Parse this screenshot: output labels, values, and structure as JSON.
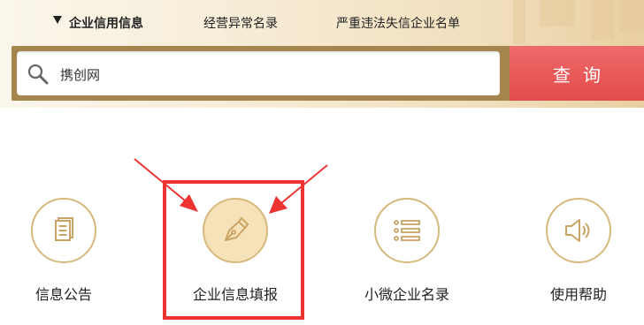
{
  "tabs": [
    {
      "label": "企业信用信息",
      "active": true
    },
    {
      "label": "经营异常名录",
      "active": false
    },
    {
      "label": "严重违法失信企业名单",
      "active": false
    }
  ],
  "search": {
    "value": "携创网",
    "icon": "search-icon",
    "button_label": "查询"
  },
  "services": [
    {
      "label": "信息公告",
      "icon": "document-icon"
    },
    {
      "label": "企业信息填报",
      "icon": "pen-nib-icon",
      "highlighted": true
    },
    {
      "label": "小微企业名录",
      "icon": "list-icon"
    },
    {
      "label": "使用帮助",
      "icon": "speaker-icon"
    }
  ],
  "colors": {
    "accent_gold": "#a5844e",
    "icon_gold": "#c9a466",
    "search_button_red": "#e34b4b",
    "highlight_red": "#ee3333"
  }
}
